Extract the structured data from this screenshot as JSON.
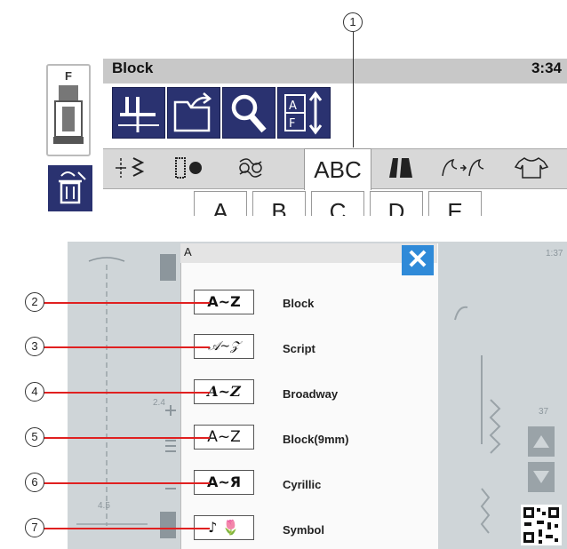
{
  "top_screen": {
    "title": "Block",
    "time": "3:34",
    "foot_code": "F",
    "tabs": [
      "ABC"
    ],
    "letters": [
      "A",
      "B",
      "C",
      "D",
      "E"
    ],
    "callout": "1"
  },
  "dialog": {
    "title": "A",
    "close_symbol": "✕",
    "background_time": "1:37",
    "options": [
      {
        "callout": "2",
        "sample": "A~Z",
        "label": "Block"
      },
      {
        "callout": "3",
        "sample": "𝒜~𝒵",
        "label": "Script"
      },
      {
        "callout": "4",
        "sample": "A~Z",
        "label": "Broadway"
      },
      {
        "callout": "5",
        "sample": "A~Z",
        "label": "Block(9mm)"
      },
      {
        "callout": "6",
        "sample": "A~Я",
        "label": "Cyrillic"
      },
      {
        "callout": "7",
        "sample": "♪ 🌷",
        "label": "Symbol"
      }
    ]
  },
  "background_readings": [
    "2.4",
    "4.5",
    "37"
  ],
  "colors": {
    "accent_navy": "#2a3270",
    "close_blue": "#2f8ad8",
    "callout_red": "#e02020"
  }
}
